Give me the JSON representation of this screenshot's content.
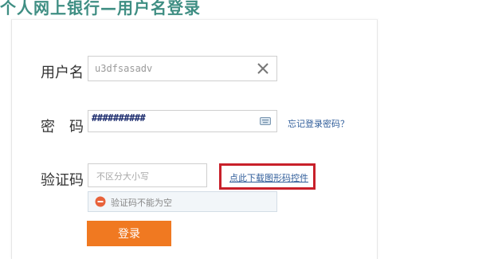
{
  "page": {
    "title": "个人网上银行—用户名登录"
  },
  "form": {
    "username_label": "用户名",
    "username_value": "u3dfsasadv",
    "password_label": "密码",
    "password_value": "##########",
    "forgot_link": "忘记登录密码？",
    "captcha_label": "验证码",
    "captcha_placeholder": "不区分大小写",
    "download_link": "点此下载图形码控件",
    "error_text": "验证码不能为空",
    "login_button": "登录"
  },
  "icons": {
    "clear": "close-icon",
    "keyboard": "keyboard-icon",
    "error": "minus-circle-icon"
  },
  "colors": {
    "title": "#3f8e83",
    "login_button": "#f07921",
    "highlight_border": "#c8202a",
    "link": "#2f5d9a",
    "error_icon": "#e8623a"
  }
}
